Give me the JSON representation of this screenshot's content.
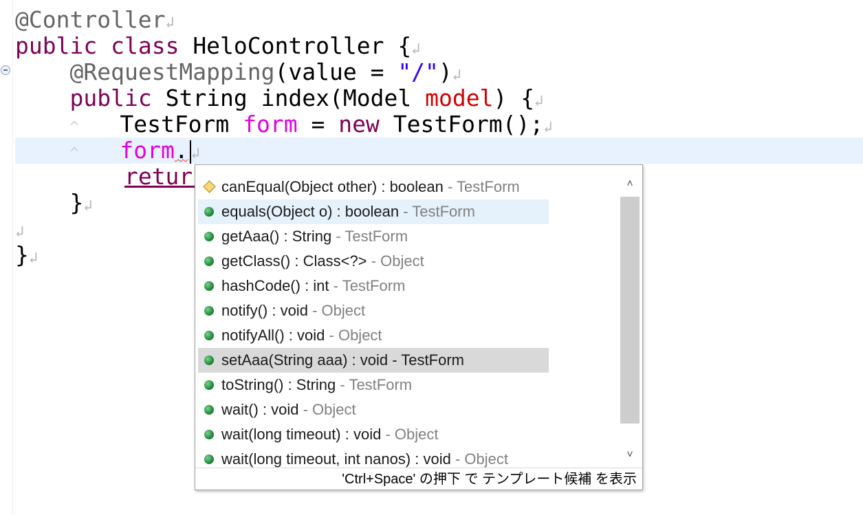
{
  "editor": {
    "eol_mark": "↲",
    "indent_mark": "^",
    "lines": {
      "l1": {
        "annotation": "@Controller"
      },
      "l2": {
        "kw_public": "public",
        "kw_class": "class",
        "class_name": "HeloController",
        "brace": "{"
      },
      "l3": {
        "annotation": "@RequestMapping",
        "open": "(value = ",
        "value": "\"/\"",
        "close": ")"
      },
      "l4": {
        "kw_public": "public",
        "type": "String",
        "method": "index(Model",
        "param": "model",
        "close": ")",
        "brace": "{"
      },
      "l5": {
        "type": "TestForm",
        "var": "form",
        "eq": "=",
        "kw_new": "new",
        "ctor": "TestForm();"
      },
      "l6": {
        "var": "form",
        "dot": "."
      },
      "l7": {
        "kw_return": "return"
      },
      "l8": {
        "brace": "}"
      },
      "l10": {
        "brace": "}"
      }
    }
  },
  "content_assist": {
    "proposals": [
      {
        "signature": "canEqual(Object other) : boolean",
        "owner": "- TestForm",
        "icon": "protected-method-icon"
      },
      {
        "signature": "equals(Object o) : boolean",
        "owner": "- TestForm",
        "icon": "public-method-icon"
      },
      {
        "signature": "getAaa() : String",
        "owner": "- TestForm",
        "icon": "public-method-icon"
      },
      {
        "signature": "getClass() : Class<?>",
        "owner": "- Object",
        "icon": "public-method-icon"
      },
      {
        "signature": "hashCode() : int",
        "owner": "- TestForm",
        "icon": "public-method-icon"
      },
      {
        "signature": "notify() : void",
        "owner": "- Object",
        "icon": "public-method-icon"
      },
      {
        "signature": "notifyAll() : void",
        "owner": "- Object",
        "icon": "public-method-icon"
      },
      {
        "signature": "setAaa(String aaa) : void",
        "owner": "- TestForm",
        "icon": "public-method-icon"
      },
      {
        "signature": "toString() : String",
        "owner": "- TestForm",
        "icon": "public-method-icon"
      },
      {
        "signature": "wait() : void",
        "owner": "- Object",
        "icon": "public-method-icon"
      },
      {
        "signature": "wait(long timeout) : void",
        "owner": "- Object",
        "icon": "public-method-icon"
      },
      {
        "signature": "wait(long timeout, int nanos) : void",
        "owner": "- Object",
        "icon": "public-method-icon"
      }
    ],
    "hovered_index": 1,
    "selected_index": 7,
    "scroll_up": "˄",
    "scroll_down": "˅",
    "footer": "'Ctrl+Space' の押下 で テンプレート候補 を表示"
  }
}
